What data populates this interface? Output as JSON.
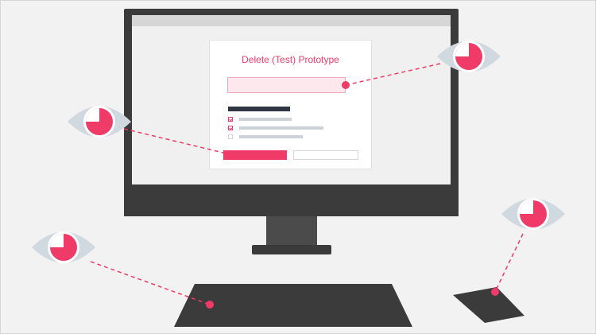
{
  "dialog": {
    "title": "Delete (Test) Prototype"
  },
  "colors": {
    "accent": "#f03a67",
    "monitor": "#3b3b3b",
    "eye": "#d0d8e0",
    "background": "#f2f2f2"
  },
  "icons": [
    "eye-icon",
    "keyboard",
    "mouse",
    "monitor"
  ]
}
